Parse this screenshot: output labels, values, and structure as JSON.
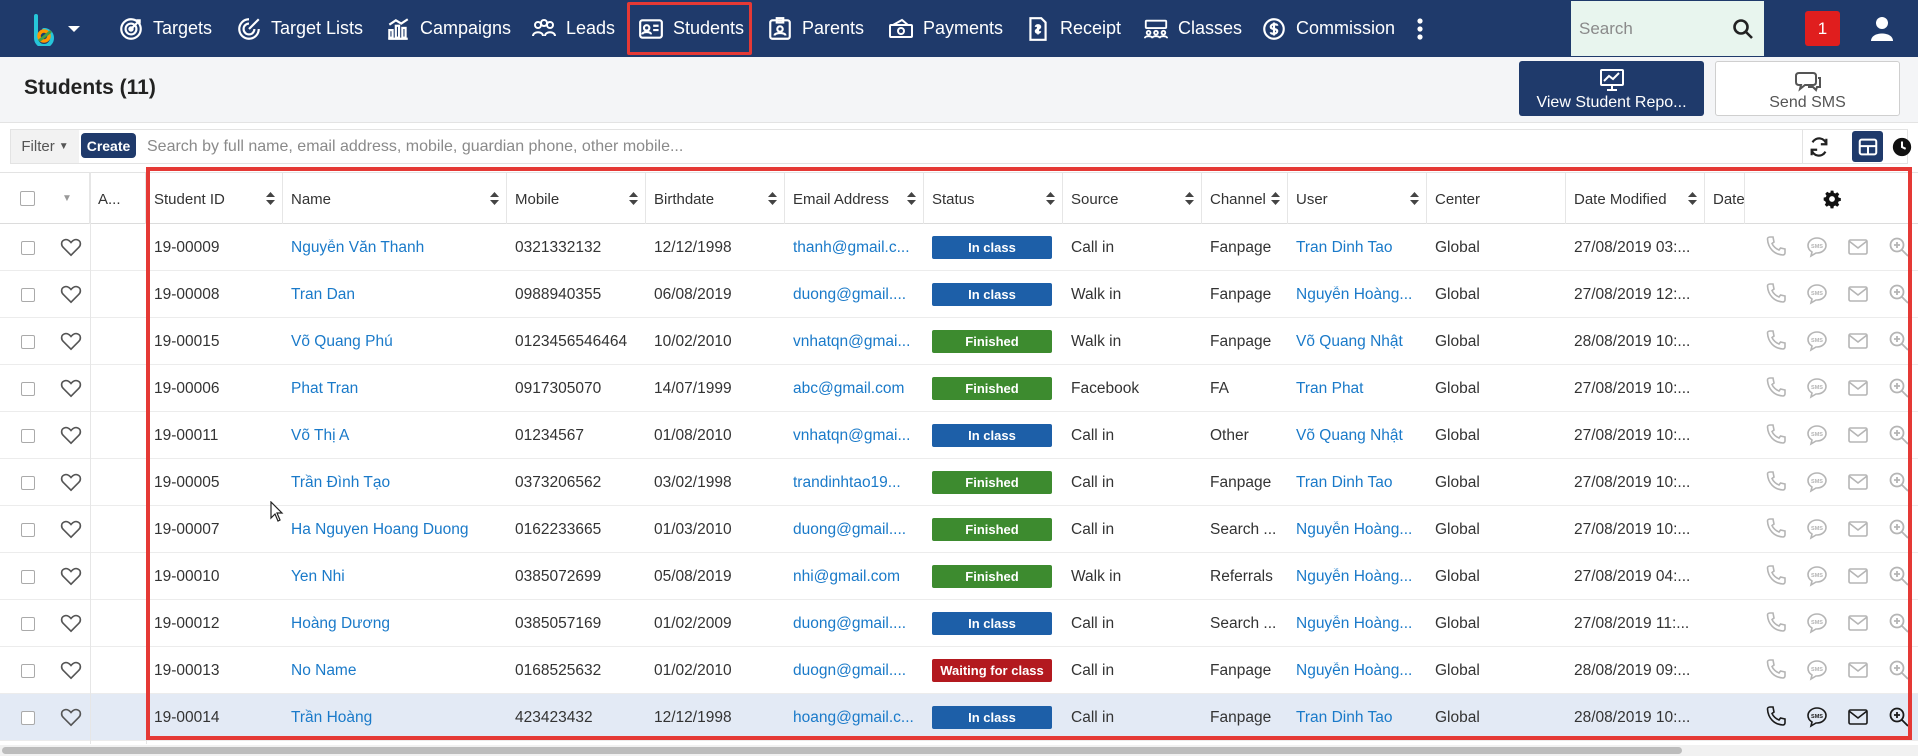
{
  "nav": {
    "items": [
      {
        "label": "Targets",
        "icon": "target-icon"
      },
      {
        "label": "Target Lists",
        "icon": "target-list-icon"
      },
      {
        "label": "Campaigns",
        "icon": "campaign-chart-icon"
      },
      {
        "label": "Leads",
        "icon": "leads-users-icon"
      },
      {
        "label": "Students",
        "icon": "student-card-icon"
      },
      {
        "label": "Parents",
        "icon": "parent-badge-icon"
      },
      {
        "label": "Payments",
        "icon": "payment-money-icon"
      },
      {
        "label": "Receipt",
        "icon": "receipt-icon"
      },
      {
        "label": "Classes",
        "icon": "classes-icon"
      },
      {
        "label": "Commission",
        "icon": "commission-dollar-icon"
      }
    ],
    "active": "Students",
    "search_placeholder": "Search",
    "notification_count": "1"
  },
  "page": {
    "title": "Students (11)",
    "report_button": "View Student Repo...",
    "sms_button": "Send SMS"
  },
  "filterbar": {
    "filter_label": "Filter",
    "create_label": "Create",
    "search_placeholder": "Search by full name, email address, mobile, guardian phone, other mobile..."
  },
  "table": {
    "headers": {
      "assigned": "A...",
      "student_id": "Student ID",
      "name": "Name",
      "mobile": "Mobile",
      "birthdate": "Birthdate",
      "email": "Email Address",
      "status": "Status",
      "source": "Source",
      "channel": "Channel",
      "user": "User",
      "center": "Center",
      "date_modified": "Date Modified",
      "date": "Date"
    },
    "rows": [
      {
        "id": "19-00009",
        "name": "Nguyễn Văn Thanh",
        "mobile": "0321332132",
        "birthdate": "12/12/1998",
        "email": "thanh@gmail.c...",
        "status": "In class",
        "source": "Call in",
        "channel": "Fanpage",
        "user": "Tran Dinh Tao",
        "center": "Global",
        "modified": "27/08/2019 03:..."
      },
      {
        "id": "19-00008",
        "name": "Tran Dan",
        "mobile": "0988940355",
        "birthdate": "06/08/2019",
        "email": "duong@gmail....",
        "status": "In class",
        "source": "Walk in",
        "channel": "Fanpage",
        "user": "Nguyễn Hoàng...",
        "center": "Global",
        "modified": "27/08/2019 12:..."
      },
      {
        "id": "19-00015",
        "name": "Võ Quang Phú",
        "mobile": "0123456546464",
        "birthdate": "10/02/2010",
        "email": "vnhatqn@gmai...",
        "status": "Finished",
        "source": "Walk in",
        "channel": "Fanpage",
        "user": "Võ Quang Nhật",
        "center": "Global",
        "modified": "28/08/2019 10:..."
      },
      {
        "id": "19-00006",
        "name": "Phat Tran",
        "mobile": "0917305070",
        "birthdate": "14/07/1999",
        "email": "abc@gmail.com",
        "status": "Finished",
        "source": "Facebook",
        "channel": "FA",
        "user": "Tran Phat",
        "center": "Global",
        "modified": "27/08/2019 10:..."
      },
      {
        "id": "19-00011",
        "name": "Võ Thị A",
        "mobile": "01234567",
        "birthdate": "01/08/2010",
        "email": "vnhatqn@gmai...",
        "status": "In class",
        "source": "Call in",
        "channel": "Other",
        "user": "Võ Quang Nhật",
        "center": "Global",
        "modified": "27/08/2019 10:..."
      },
      {
        "id": "19-00005",
        "name": "Trần Đình Tạo",
        "mobile": "0373206562",
        "birthdate": "03/02/1998",
        "email": "trandinhtao19...",
        "status": "Finished",
        "source": "Call in",
        "channel": "Fanpage",
        "user": "Tran Dinh Tao",
        "center": "Global",
        "modified": "27/08/2019 10:..."
      },
      {
        "id": "19-00007",
        "name": "Ha Nguyen Hoang Duong",
        "mobile": "0162233665",
        "birthdate": "01/03/2010",
        "email": "duong@gmail....",
        "status": "Finished",
        "source": "Call in",
        "channel": "Search ...",
        "user": "Nguyễn Hoàng...",
        "center": "Global",
        "modified": "27/08/2019 10:..."
      },
      {
        "id": "19-00010",
        "name": "Yen Nhi",
        "mobile": "0385072699",
        "birthdate": "05/08/2019",
        "email": "nhi@gmail.com",
        "status": "Finished",
        "source": "Walk in",
        "channel": "Referrals",
        "user": "Nguyễn Hoàng...",
        "center": "Global",
        "modified": "27/08/2019 04:..."
      },
      {
        "id": "19-00012",
        "name": "Hoàng Dương",
        "mobile": "0385057169",
        "birthdate": "01/02/2009",
        "email": "duong@gmail....",
        "status": "In class",
        "source": "Call in",
        "channel": "Search ...",
        "user": "Nguyễn Hoàng...",
        "center": "Global",
        "modified": "27/08/2019 11:..."
      },
      {
        "id": "19-00013",
        "name": "No Name",
        "mobile": "0168525632",
        "birthdate": "01/02/2010",
        "email": "duogn@gmail....",
        "status": "Waiting for class",
        "source": "Call in",
        "channel": "Fanpage",
        "user": "Nguyễn Hoàng...",
        "center": "Global",
        "modified": "28/08/2019 09:..."
      },
      {
        "id": "19-00014",
        "name": "Trần Hoàng",
        "mobile": "423423432",
        "birthdate": "12/12/1998",
        "email": "hoang@gmail.c...",
        "status": "In class",
        "source": "Call in",
        "channel": "Fanpage",
        "user": "Tran Dinh Tao",
        "center": "Global",
        "modified": "28/08/2019 10:..."
      }
    ],
    "selected_row": 10
  },
  "colors": {
    "nav_bg": "#1f3a6b",
    "link": "#1a7ac9",
    "status_in_class": "#1d5fa8",
    "status_finished": "#3d8b2f",
    "status_waiting": "#b3191f",
    "highlight": "#e53935"
  }
}
